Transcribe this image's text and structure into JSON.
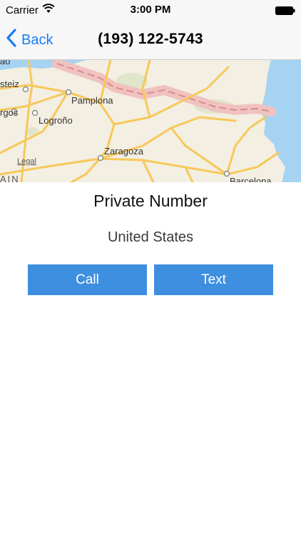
{
  "status_bar": {
    "carrier": "Carrier",
    "time": "3:00 PM",
    "wifi_icon": "wifi-icon",
    "battery_icon": "battery-icon"
  },
  "nav": {
    "back_label": "Back",
    "back_icon": "chevron-left-icon",
    "title": "(193) 122-5743"
  },
  "map": {
    "labels": {
      "pamplona": "Pamplona",
      "logrono": "Logroño",
      "zaragoza": "Zaragoza",
      "barcelona": "Barcelona",
      "legal": "Legal",
      "steiz": "steiz",
      "rgos": "rgos",
      "ao": "ao",
      "ain": "AIN"
    },
    "colors": {
      "land": "#f3efe2",
      "water": "#a6d3f2",
      "road": "#f7c85a",
      "border": "#e2a8a8"
    }
  },
  "contact": {
    "name": "Private Number",
    "country": "United States"
  },
  "actions": {
    "call_label": "Call",
    "text_label": "Text"
  },
  "colors": {
    "accent": "#1a7cf5",
    "button": "#3f8fe0"
  }
}
